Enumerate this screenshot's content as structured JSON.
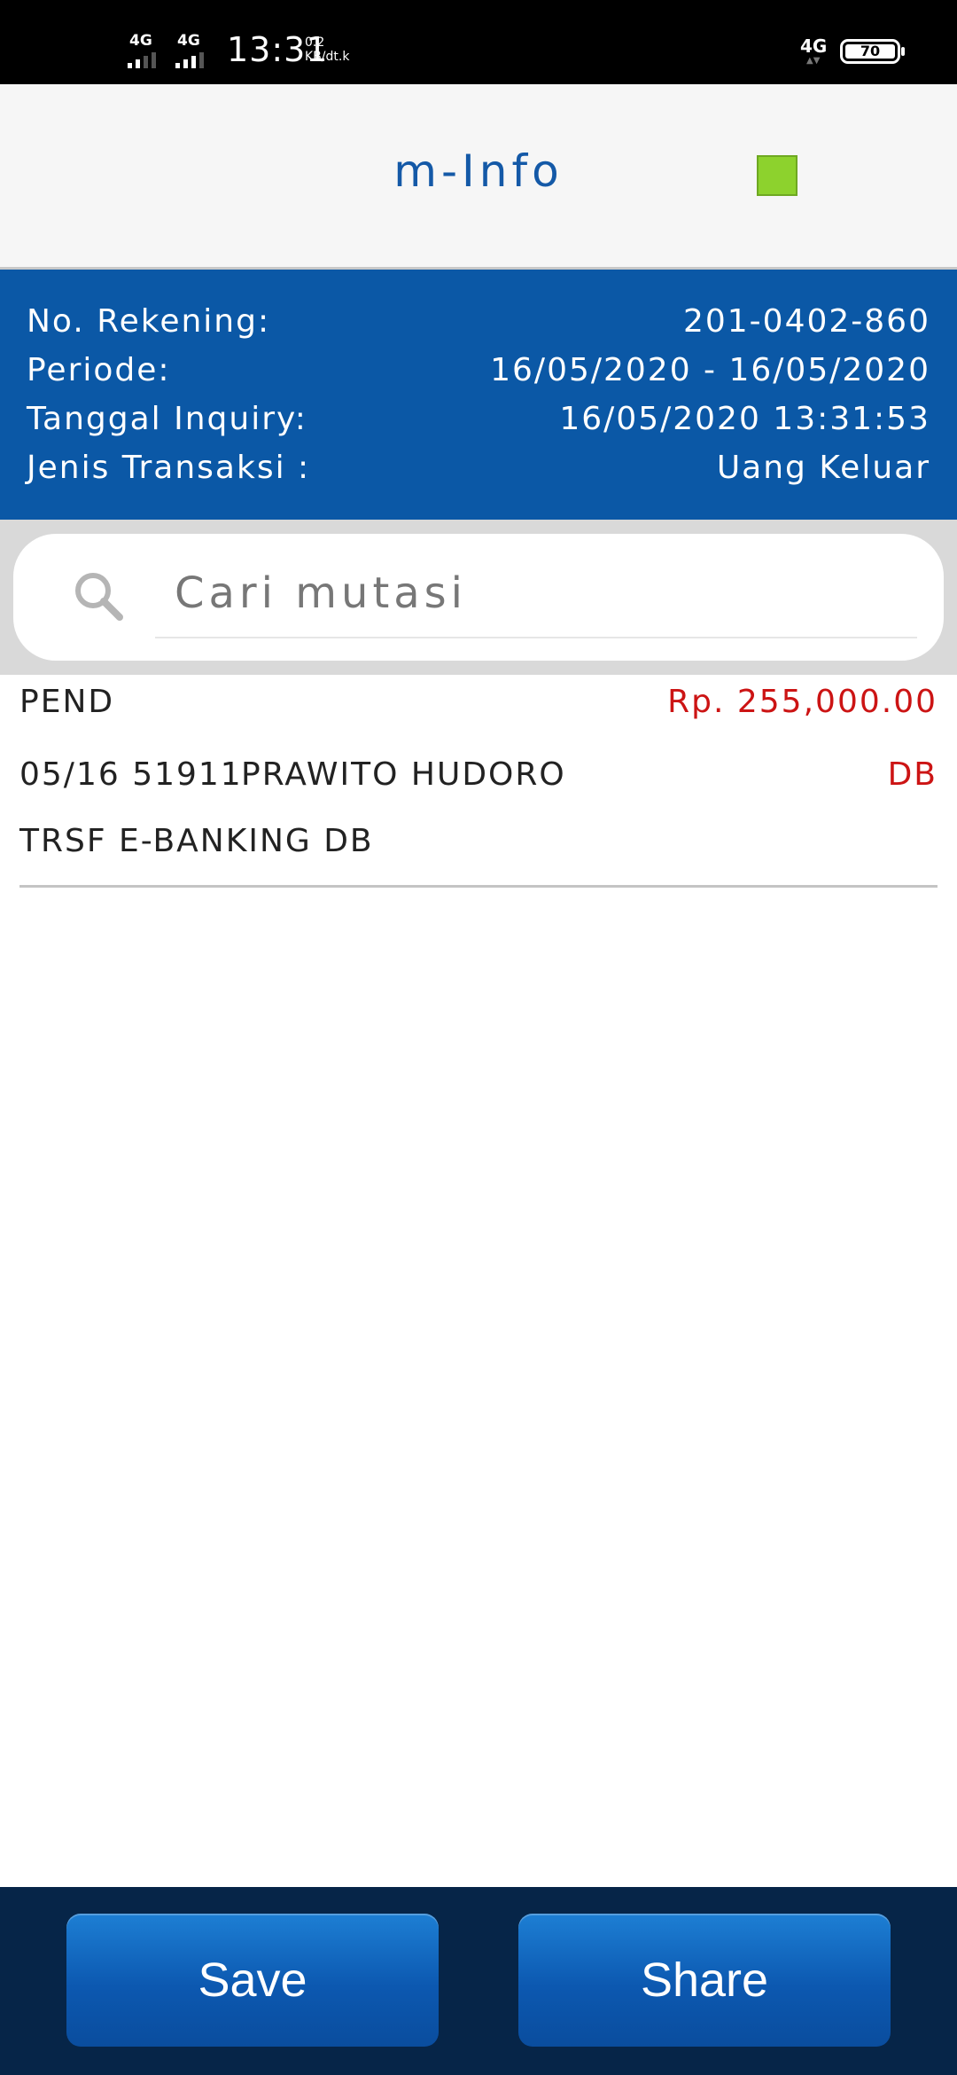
{
  "status_bar": {
    "network_1": "4G",
    "network_2": "4G",
    "time": "13:31",
    "speed_value": "0.2",
    "speed_unit": "KB/dt.k",
    "network_right": "4G",
    "battery": "70"
  },
  "header": {
    "title": "m-Info",
    "indicator_color": "#8dd22d"
  },
  "info": {
    "rekening_label": "No. Rekening:",
    "rekening_value": "201-0402-860",
    "periode_label": "Periode:",
    "periode_value": "16/05/2020 - 16/05/2020",
    "inquiry_label": "Tanggal Inquiry:",
    "inquiry_value": "16/05/2020 13:31:53",
    "jenis_label": "Jenis Transaksi :",
    "jenis_value": "Uang Keluar"
  },
  "search": {
    "placeholder": "Cari mutasi",
    "value": ""
  },
  "transactions": [
    {
      "status": "PEND",
      "amount": "Rp. 255,000.00",
      "date_code": "05/16 51911",
      "name": "PRAWITO HUDORO",
      "type": "DB",
      "description": "TRSF E-BANKING DB"
    }
  ],
  "actions": {
    "save_label": "Save",
    "share_label": "Share"
  },
  "colors": {
    "primary_blue": "#0b58a6",
    "amount_red": "#cc1414",
    "bottom_bar": "#062548"
  }
}
